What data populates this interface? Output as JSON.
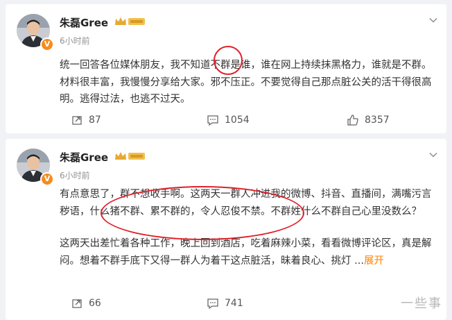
{
  "posts": [
    {
      "user": "朱磊Gree",
      "time": "6小时前",
      "verified": "V",
      "text": "统一回答各位媒体朋友，我不知道不群是谁，谁在网上持续抹黑格力，谁就是不群。材料很丰富，我慢慢分享给大家。邪不压正。不要觉得自己那点脏公关的活干得很高明。逃得过法，也逃不过天。",
      "reposts": "87",
      "comments": "1054",
      "likes": "8357"
    },
    {
      "user": "朱磊Gree",
      "time": "6小时前",
      "verified": "V",
      "text1": "有点意思了，群不想收手啊。这两天一群人冲进我的微博、抖音、直播间，满嘴污言秽语，什么猪不群、累不群的，令人忍俊不禁。不群姓什么不群自己心里没数么？",
      "text2": "这两天出差忙着各种工作，晚上回到酒店，吃着麻辣小菜，看看微博评论区，真是解闷。想着不群手底下又得一群人为着干这点脏活，昧着良心、挑灯 ...",
      "expand": "展开",
      "reposts": "66",
      "comments": "741"
    }
  ],
  "watermark": "一些事",
  "colors": {
    "accent": "#ff8200",
    "annotation": "#e0202a",
    "badge": "#f68b1e"
  },
  "icons": [
    "repost-icon",
    "comment-icon",
    "like-icon",
    "chevron-down-icon",
    "crown-icon"
  ]
}
